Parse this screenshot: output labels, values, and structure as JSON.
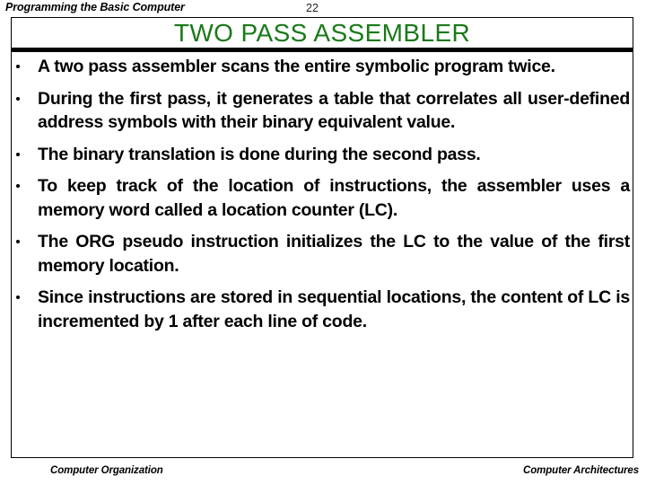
{
  "header": {
    "title": "Programming the Basic Computer",
    "page_number": "22"
  },
  "slide": {
    "title": "TWO PASS ASSEMBLER",
    "title_color": "#1a7a1a",
    "bullets": [
      {
        "text": "A two pass assembler scans the entire symbolic program twice."
      },
      {
        "text": "During the first pass, it generates a table that correlates all user-defined address symbols with their binary equivalent value."
      },
      {
        "text": "The binary translation is done during the second pass."
      },
      {
        "text": "To keep track of the location of instructions, the assembler uses a memory word called a location counter (LC)."
      },
      {
        "text": "The ORG pseudo instruction initializes the LC to the value of the first memory location."
      },
      {
        "text": "Since instructions are stored in sequential locations, the content of LC is incremented by 1 after each line of code."
      }
    ]
  },
  "footer": {
    "left": "Computer Organization",
    "right": "Computer Architectures"
  }
}
